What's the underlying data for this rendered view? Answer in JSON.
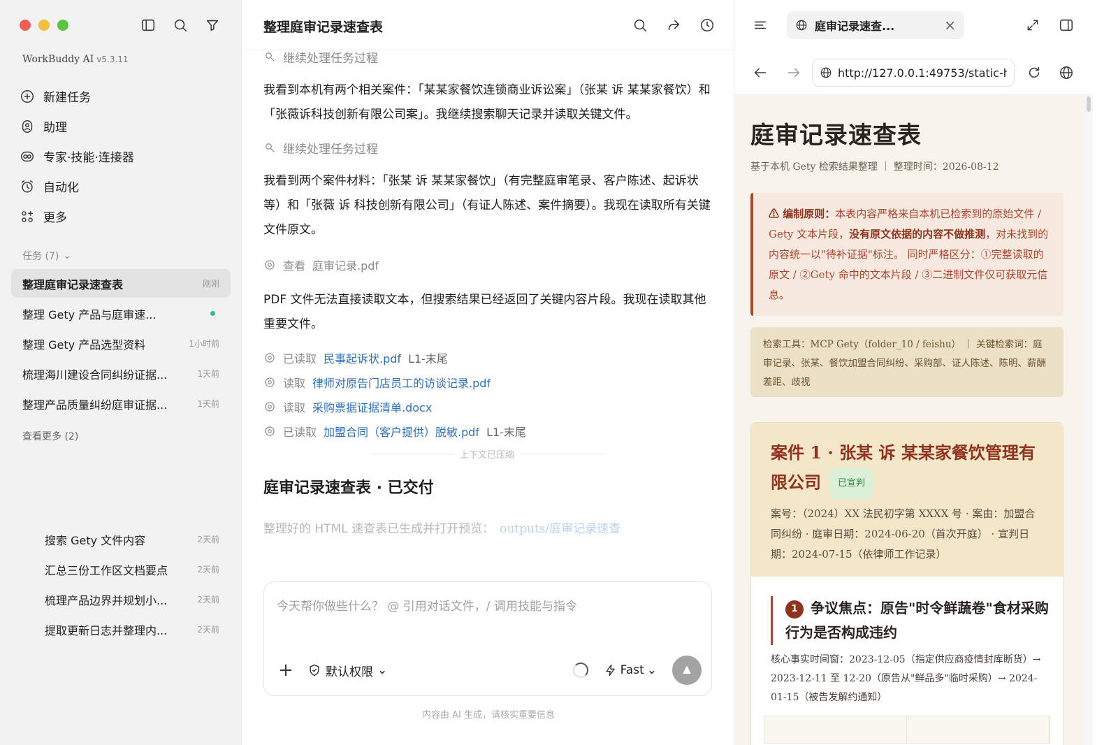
{
  "sidebar": {
    "app_name": "WorkBuddy AI",
    "version": "v5.3.11",
    "nav": [
      {
        "label": "新建任务",
        "icon": "plus-circle-icon"
      },
      {
        "label": "助理",
        "icon": "assistant-icon"
      },
      {
        "label": "专家·技能·连接器",
        "icon": "link-icon"
      },
      {
        "label": "自动化",
        "icon": "alarm-clock-icon"
      },
      {
        "label": "更多",
        "icon": "grid-icon"
      }
    ],
    "tasks_label": "任务 (7)",
    "tasks": [
      {
        "title": "整理庭审记录速查表",
        "time": "刚刚",
        "active": true
      },
      {
        "title": "整理 Gety 产品与庭审速...",
        "time": "",
        "running": true
      },
      {
        "title": "整理 Gety 产品选型资料",
        "time": "1小时前"
      },
      {
        "title": "梳理海川建设合同纠纷证据...",
        "time": "1天前"
      },
      {
        "title": "整理产品质量纠纷庭审证据...",
        "time": "1天前"
      }
    ],
    "see_more": "查看更多 (2)",
    "history": [
      {
        "title": "搜索 Gety 文件内容",
        "time": "2天前"
      },
      {
        "title": "汇总三份工作区文档要点",
        "time": "2天前"
      },
      {
        "title": "梳理产品边界并规划小...",
        "time": "2天前"
      },
      {
        "title": "提取更新日志并整理内...",
        "time": "2天前"
      }
    ]
  },
  "chat": {
    "title": "整理庭审记录速查表",
    "step1": "继续处理任务过程",
    "para1": "我看到本机有两个相关案件：「某某家餐饮连锁商业诉讼案」（张某 诉 某某家餐饮）和「张薇诉科技创新有限公司案」。我继续搜索聊天记录并读取关键文件。",
    "step2": "继续处理任务过程",
    "para2": "我看到两个案件材料：「张某 诉 某某家餐饮」（有完整庭审笔录、客户陈述、起诉状等）和「张薇 诉 科技创新有限公司」（有证人陈述、案件摘要）。我现在读取所有关键文件原文。",
    "view_step": {
      "action": "查看",
      "file": "庭审记录.pdf"
    },
    "para3": "PDF 文件无法直接读取文本，但搜索结果已经返回了关键内容片段。我现在读取其他重要文件。",
    "file_steps": [
      {
        "action": "已读取",
        "file": "民事起诉状.pdf",
        "range": "L1-末尾"
      },
      {
        "action": "读取",
        "file": "律师对原告门店员工的访谈记录.pdf",
        "range": ""
      },
      {
        "action": "读取",
        "file": "采购票据证据清单.docx",
        "range": ""
      },
      {
        "action": "已读取",
        "file": "加盟合同（客户提供）脱敏.pdf",
        "range": "L1-末尾"
      }
    ],
    "compressed": "上下文已压缩",
    "delivered_title": "庭审记录速查表 · 已交付",
    "delivered_text": "整理好的 HTML 速查表已生成并打开预览：",
    "delivered_link": "outputs/庭审记录速查",
    "composer": {
      "placeholder": "今天帮你做些什么？ @ 引用对话文件，/ 调用技能与指令",
      "permission": "默认权限",
      "mode": "Fast"
    },
    "disclaimer": "内容由 AI 生成，请核实重要信息"
  },
  "browser": {
    "tab_title": "庭审记录速查...",
    "url": "http://127.0.0.1:49753/static-h",
    "doc": {
      "title": "庭审记录速查表",
      "subtitle": "基于本机 Gety 检索结果整理 ｜ 整理时间：2026-08-12",
      "warn_label": "⚠ 编制原则：",
      "warn_text_1": "本表内容严格来自本机已检索到的原始文件 / Gety 文本片段，",
      "warn_bold": "没有原文依据的内容不做推测",
      "warn_text_2": "，对未找到的内容统一以\"待补证据\"标注。 同时严格区分：①完整读取的原文 / ②Gety 命中的文本片段 / ③二进制文件仅可获取元信息。",
      "tools_text": "检索工具：MCP Gety（folder_10 / feishu） ｜ 关键检索词：庭审记录、张某、餐饮加盟合同纠纷、采购部、证人陈述、陈明、薪酬差距、歧视",
      "case_title": "案件 1 · 张某 诉 某某家餐饮管理有限公司",
      "case_status": "已宣判",
      "case_meta": "案号：（2024）XX 法民初字第 XXXX 号 · 案由：加盟合同纠纷 · 庭审日期：2024-06-20（首次开庭） · 宣判日期：2024-07-15（依律师工作记录）",
      "issue_num": "1",
      "issue_title": "争议焦点：原告\"时令鲜蔬卷\"食材采购行为是否构成违约",
      "issue_body": "核心事实时间窗：2023-12-05（指定供应商疫情封库断货）→ 2023-12-11 至 12-20（原告从\"鲜品多\"临时采购）→ 2024-01-15（被告发解约通知）"
    }
  },
  "colors": {
    "accent_link": "#2f6fb5",
    "doc_red": "#a8462f",
    "doc_bg": "#f8f4ec",
    "badge_green": "#2f7c43"
  }
}
